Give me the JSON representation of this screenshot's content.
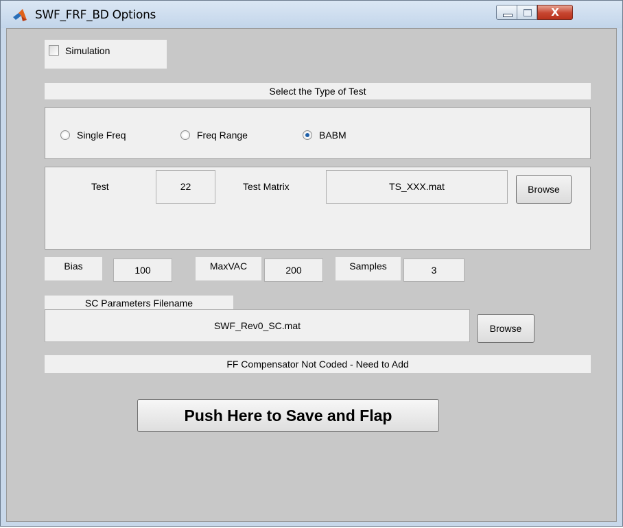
{
  "window": {
    "title": "SWF_FRF_BD Options",
    "controls": {
      "minimize": "minimize",
      "maximize": "maximize",
      "close": "X"
    }
  },
  "simulation": {
    "label": "Simulation",
    "checked": false
  },
  "test_type": {
    "header": "Select the Type of Test",
    "options": [
      {
        "label": "Single Freq",
        "selected": false
      },
      {
        "label": "Freq Range",
        "selected": false
      },
      {
        "label": "BABM",
        "selected": true
      }
    ]
  },
  "test": {
    "test_label": "Test",
    "test_value": "22",
    "matrix_label": "Test Matrix",
    "matrix_value": "TS_XXX.mat",
    "browse_label": "Browse"
  },
  "params": {
    "bias_label": "Bias",
    "bias_value": "100",
    "maxvac_label": "MaxVAC",
    "maxvac_value": "200",
    "samples_label": "Samples",
    "samples_value": "3"
  },
  "sc": {
    "label": "SC Parameters Filename",
    "filename": "SWF_Rev0_SC.mat",
    "browse_label": "Browse"
  },
  "status": {
    "message": "FF Compensator Not Coded - Need to Add"
  },
  "action": {
    "label": "Push Here to Save and Flap"
  },
  "colors": {
    "panel": "#f0f0f0",
    "background": "#c8c8c8",
    "radio_accent": "#1e5fa8",
    "close_button": "#c64530"
  }
}
